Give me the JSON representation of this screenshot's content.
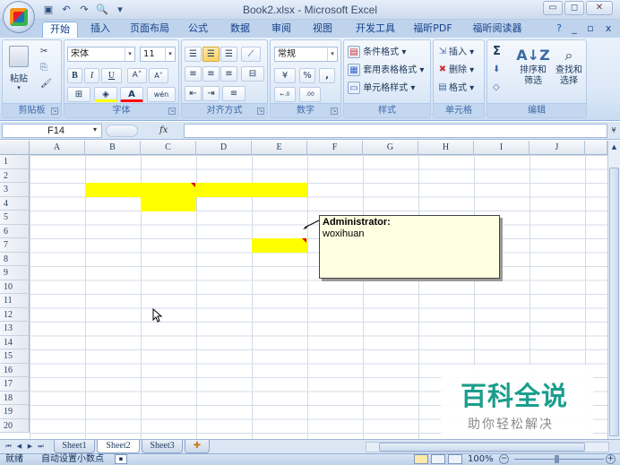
{
  "window": {
    "title": "Book2.xlsx - Microsoft Excel",
    "min": "▭",
    "max": "◻",
    "close": "✕"
  },
  "quick_access": [
    {
      "icon": "save-icon",
      "glyph": "▣"
    },
    {
      "icon": "undo-icon",
      "glyph": "↶"
    },
    {
      "icon": "redo-icon",
      "glyph": "↷"
    },
    {
      "icon": "print-preview-icon",
      "glyph": "🔍"
    },
    {
      "icon": "customize-icon",
      "glyph": "▾"
    }
  ],
  "tabs": [
    "开始",
    "插入",
    "页面布局",
    "公式",
    "数据",
    "审阅",
    "视图",
    "开发工具",
    "福昕PDF",
    "福昕阅读器"
  ],
  "ribbon_right": {
    "help": "?",
    "min": "_",
    "restore": "▫",
    "close": "x"
  },
  "clipboard": {
    "paste": "粘贴",
    "cut": "✂",
    "copy": "⎘",
    "painter": "🖌",
    "label": "剪贴板"
  },
  "font": {
    "name": "宋体",
    "size": "11",
    "bold": "B",
    "italic": "I",
    "underline": "U",
    "grow": "A˄",
    "shrink": "A˅",
    "border": "⊞",
    "fill": "◈",
    "color": "A",
    "phonetic": "wén",
    "label": "字体"
  },
  "alignment": {
    "label": "对齐方式",
    "wrap": "≡",
    "merge": "⊟",
    "indent_dec": "⇤",
    "indent_inc": "⇥",
    "orient": "⟋"
  },
  "number": {
    "format": "常规",
    "currency": "¥",
    "percent": "%",
    "comma": ",",
    "inc": "←.0 .00",
    "dec": ".00 →.0",
    "label": "数字"
  },
  "styles": {
    "conditional": "条件格式",
    "table": "套用表格格式",
    "cell": "单元格样式",
    "label": "样式"
  },
  "cells": {
    "insert": "插入",
    "delete": "删除",
    "format": "格式",
    "label": "单元格"
  },
  "editing": {
    "sum": "Σ",
    "fill": "⬇",
    "clear": "◇",
    "sort": "排序和筛选",
    "find": "查找和选择",
    "label": "编辑"
  },
  "formula": {
    "namebox": "F14",
    "fx": "fx",
    "value": ""
  },
  "columns": [
    "A",
    "B",
    "C",
    "D",
    "E",
    "F",
    "G",
    "H",
    "I",
    "J"
  ],
  "rows": [
    "1",
    "2",
    "3",
    "4",
    "5",
    "6",
    "7",
    "8",
    "9",
    "10",
    "11",
    "12",
    "13",
    "14",
    "15",
    "16",
    "17",
    "18",
    "19",
    "20"
  ],
  "comment": {
    "author": "Administrator:",
    "text": "woxihuan"
  },
  "sheets": [
    "Sheet1",
    "Sheet2",
    "Sheet3"
  ],
  "status": {
    "ready": "就绪",
    "auto_decimal": "自动设置小数点",
    "zoom": "100%"
  },
  "watermark": {
    "big": "百科全说",
    "small": "助你轻松解决"
  },
  "colors": {
    "highlight": "#ffff00",
    "comment_bg": "#ffffe1",
    "watermark": "#1b9e8c"
  }
}
